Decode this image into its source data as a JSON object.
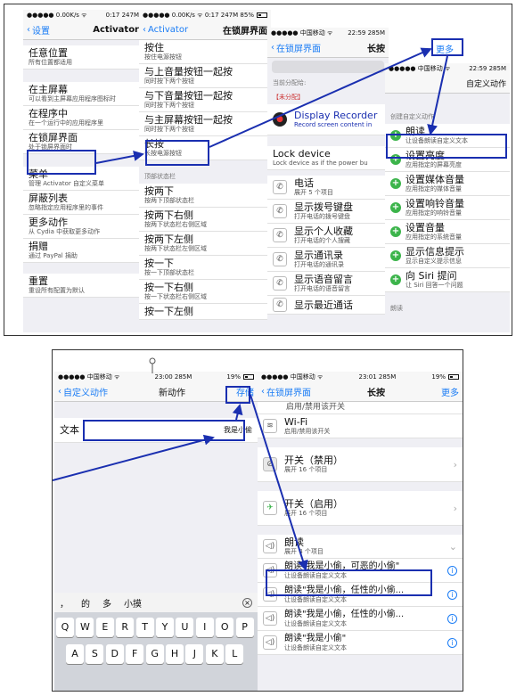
{
  "top": {
    "p1": {
      "status": {
        "left": "●●●●● 0.00K/s ᯤ",
        "time": "0:17 247M"
      },
      "nav": {
        "back": "设置",
        "title": "Activator"
      },
      "rows": [
        {
          "t": "任意位置",
          "s": "所有位置都适用"
        },
        {
          "t": "在主屏幕",
          "s": "可以看到主屏幕应用程序图标时"
        },
        {
          "t": "在程序中",
          "s": "在一个运行中的应用程序里"
        },
        {
          "t": "在锁屏界面",
          "s": "处于锁屏界面时"
        },
        {
          "t": "菜单",
          "s": "管理 Activator 自定义菜单"
        },
        {
          "t": "屏蔽列表",
          "s": "忽略指定应用程序里的事件"
        },
        {
          "t": "更多动作",
          "s": "从 Cydia 中获取更多动作"
        },
        {
          "t": "捐赠",
          "s": "通过 PayPal 捐助"
        },
        {
          "t": "重置",
          "s": "重设所有配置为默认"
        }
      ]
    },
    "p2": {
      "status": {
        "left": "●●●●● 0.00K/s ᯤ",
        "time": "0:17 247M",
        "right": "85%"
      },
      "nav": {
        "back": "Activator",
        "title": "在锁屏界面"
      },
      "rows": [
        {
          "t": "按住",
          "s": "按住电源按钮"
        },
        {
          "t": "与上音量按钮一起按",
          "s": "同时按下两个按钮"
        },
        {
          "t": "与下音量按钮一起按",
          "s": "同时按下两个按钮"
        },
        {
          "t": "与主屏幕按钮一起按",
          "s": "同时按下两个按钮"
        },
        {
          "t": "长按",
          "s": "长按电源按钮"
        }
      ],
      "section": "顶部状态栏",
      "rows2": [
        {
          "t": "按两下",
          "s": "按两下顶部状态栏"
        },
        {
          "t": "按两下右侧",
          "s": "按两下状态栏右侧区域"
        },
        {
          "t": "按两下左侧",
          "s": "按两下状态栏左侧区域"
        },
        {
          "t": "按一下",
          "s": "按一下顶部状态栏"
        },
        {
          "t": "按一下右侧",
          "s": "按一下状态栏右侧区域"
        },
        {
          "t": "按一下左侧",
          "s": ""
        }
      ]
    },
    "p3": {
      "status": {
        "left": "●●●●● 中国移动 ᯤ",
        "time": "22:59 285M",
        "right": "19%"
      },
      "nav": {
        "back": "在锁屏界面",
        "title": "长按",
        "action": "更多"
      },
      "assigned_label": "当前分配给:",
      "assigned_value": "【未分配】",
      "dr": {
        "t": "Display Recorder",
        "s": "Record screen content in"
      },
      "lock": {
        "t": "Lock device",
        "s": "Lock device as if the power bu"
      },
      "phone": {
        "t": "电话",
        "s": "展开 5 个项目"
      },
      "items": [
        {
          "t": "显示拨号键盘",
          "s": "打开电话的拨号键盘"
        },
        {
          "t": "显示个人收藏",
          "s": "打开电话的个人搜藏"
        },
        {
          "t": "显示通讯录",
          "s": "打开电话的通讯录"
        },
        {
          "t": "显示语音留言",
          "s": "打开电话的语音留言"
        },
        {
          "t": "显示最近通话",
          "s": ""
        }
      ]
    },
    "p4": {
      "status": {
        "left": "●●●●● 中国移动 ᯤ",
        "time": "22:59 285M"
      },
      "nav": {
        "title": "自定义动作"
      },
      "section": "创建自定义动作",
      "items": [
        {
          "t": "朗读",
          "s": "让设备朗读自定义文本"
        },
        {
          "t": "设置亮度",
          "s": "应用指定的屏幕亮度"
        },
        {
          "t": "设置媒体音量",
          "s": "应用指定的媒体音量"
        },
        {
          "t": "设置响铃音量",
          "s": "应用指定的响铃音量"
        },
        {
          "t": "设置音量",
          "s": "应用指定的系统音量"
        },
        {
          "t": "显示信息提示",
          "s": "显示自定义提示信息"
        },
        {
          "t": "向 Siri 提问",
          "s": "让 Siri 回答一个问题"
        }
      ],
      "footer": "朗读"
    }
  },
  "bottom": {
    "p5": {
      "status": {
        "left": "●●●●● 中国移动 ᯤ",
        "time": "23:00 285M",
        "right": "19%"
      },
      "nav": {
        "back": "自定义动作",
        "title": "新动作",
        "action": "存储"
      },
      "field_label": "文本",
      "field_value": "我是小偷",
      "candidates": [
        "，",
        "的",
        "多",
        "小摸"
      ],
      "row1": [
        "Q",
        "W",
        "E",
        "R",
        "T",
        "Y",
        "U",
        "I",
        "O",
        "P"
      ],
      "row2": [
        "A",
        "S",
        "D",
        "F",
        "G",
        "H",
        "J",
        "K",
        "L"
      ]
    },
    "p6": {
      "status": {
        "left": "●●●●● 中国移动 ᯤ",
        "time": "23:01 285M",
        "right": "19%"
      },
      "nav": {
        "back": "在锁屏界面",
        "title": "长按",
        "action": "更多"
      },
      "toggle": "启用/禁用该开关",
      "wifi": "Wi-Fi",
      "wifi_sub": "启用/禁用该开关",
      "sw_off": {
        "t": "开关（禁用）",
        "s": "展开 16 个项目"
      },
      "sw_on": {
        "t": "开关（启用）",
        "s": "展开 16 个项目"
      },
      "speak": {
        "t": "朗读",
        "s": "展开 4 个项目"
      },
      "speaks": [
        {
          "t": "朗读\"我是小偷，可恶的小偷\"",
          "s": "让设备朗读自定义文本"
        },
        {
          "t": "朗读\"我是小偷，任性的小偷...",
          "s": "让设备朗读自定义文本"
        },
        {
          "t": "朗读\"我是小偷，任性的小偷...",
          "s": "让设备朗读自定义文本"
        },
        {
          "t": "朗读\"我是小偷\"",
          "s": "让设备朗读自定义文本"
        }
      ]
    }
  }
}
